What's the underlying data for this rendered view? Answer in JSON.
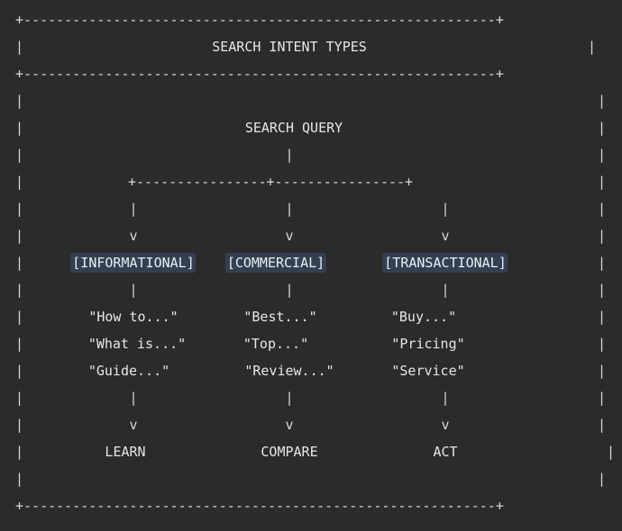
{
  "title": "SEARCH INTENT TYPES",
  "root": "SEARCH QUERY",
  "columns": [
    {
      "type": "[INFORMATIONAL]",
      "examples": [
        "\"How to...\"",
        "\"What is...\"",
        "\"Guide...\""
      ],
      "goal": "LEARN"
    },
    {
      "type": "[COMMERCIAL]",
      "examples": [
        "\"Best...\"",
        "\"Top...\"",
        "\"Review...\""
      ],
      "goal": "COMPARE"
    },
    {
      "type": "[TRANSACTIONAL]",
      "examples": [
        "\"Buy...\"",
        "\"Pricing\"",
        "\"Service\""
      ],
      "goal": "ACT"
    }
  ],
  "accent_color": "#34404f"
}
